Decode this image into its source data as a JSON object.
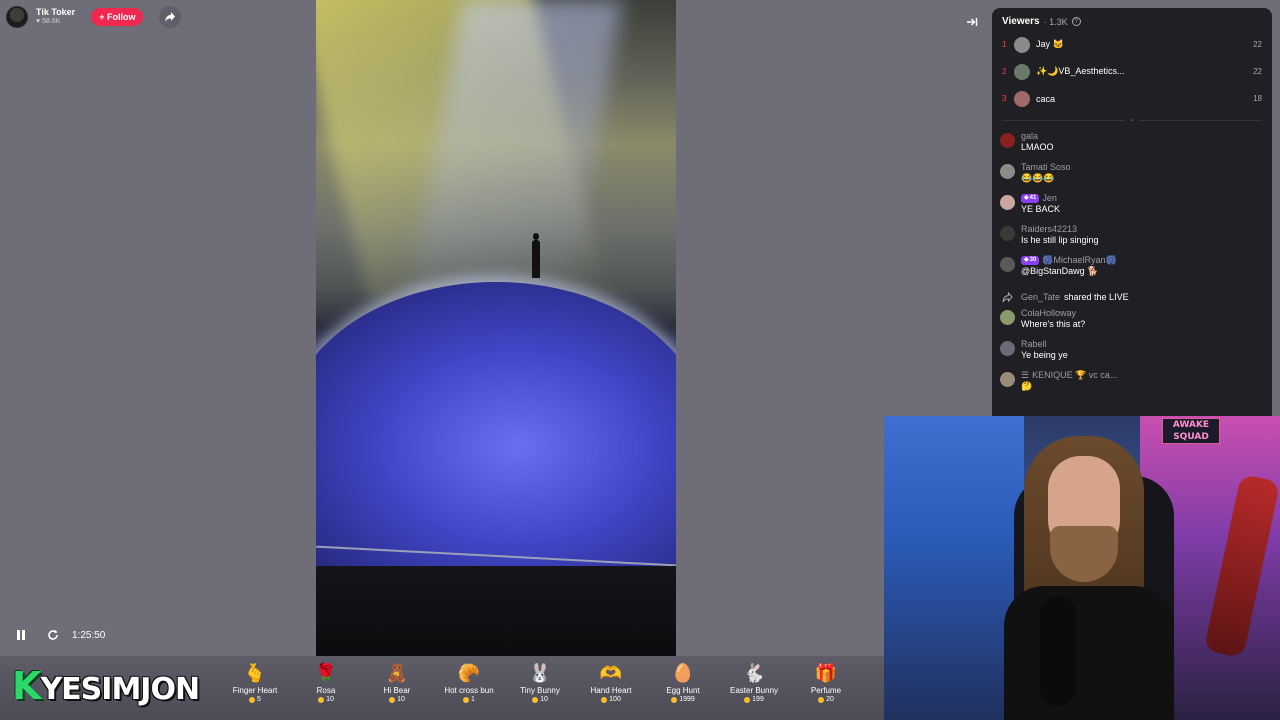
{
  "host": {
    "name": "Tik Toker",
    "likes": "58.6K",
    "follow_label": "+ Follow"
  },
  "player": {
    "timestamp": "1:25:50"
  },
  "brand": {
    "logo_k": "K",
    "logo_rest": "YESIMJON"
  },
  "gifts": [
    {
      "name": "Finger Heart",
      "price": "5",
      "icon": "🫰",
      "icon_name": "finger-heart-icon"
    },
    {
      "name": "Rosa",
      "price": "10",
      "icon": "🌹",
      "icon_name": "rose-icon"
    },
    {
      "name": "Hi Bear",
      "price": "10",
      "icon": "🧸",
      "icon_name": "bear-icon"
    },
    {
      "name": "Hot cross bun",
      "price": "1",
      "icon": "🥐",
      "icon_name": "bun-icon"
    },
    {
      "name": "Tiny Bunny",
      "price": "10",
      "icon": "🐰",
      "icon_name": "bunny-icon"
    },
    {
      "name": "Hand Heart",
      "price": "100",
      "icon": "🫶",
      "icon_name": "hand-heart-icon"
    },
    {
      "name": "Egg Hunt",
      "price": "1999",
      "icon": "🥚",
      "icon_name": "egg-icon"
    },
    {
      "name": "Easter Bunny",
      "price": "199",
      "icon": "🐇",
      "icon_name": "easter-bunny-icon"
    },
    {
      "name": "Perfume",
      "price": "20",
      "icon": "🎁",
      "icon_name": "perfume-icon"
    }
  ],
  "viewers": {
    "title": "Viewers",
    "count": "· 1.3K",
    "top": [
      {
        "rank": "1",
        "name": "Jay 🐱",
        "score": "22",
        "avatar_color": "#8a8a8a"
      },
      {
        "rank": "2",
        "name": "✨🌙VB_Aesthetics...",
        "score": "22",
        "avatar_color": "#6a7a6a"
      },
      {
        "rank": "3",
        "name": "caca",
        "score": "18",
        "avatar_color": "#a06a6a"
      }
    ]
  },
  "chat": [
    {
      "user": "gala",
      "msg": "LMAOO",
      "avatar_color": "#8a2020",
      "badge": ""
    },
    {
      "user": "Tamati Soso",
      "msg": "😂😂😂",
      "avatar_color": "#8b8b8b",
      "badge": ""
    },
    {
      "user": "Jen",
      "msg": "YE BACK",
      "avatar_color": "#c9a8a0",
      "badge": "41"
    },
    {
      "user": "Raiders42213",
      "msg": "Is he still lip singing",
      "avatar_color": "#3a3a3a",
      "badge": ""
    },
    {
      "user": "🎆MichaelRyan🎆",
      "msg": "@BigStanDawg 🐕",
      "avatar_color": "#5a5a5a",
      "badge": "30"
    },
    {
      "user": "ColaHolloway",
      "msg": "Where's this at?",
      "avatar_color": "#8a9a6a",
      "badge": ""
    },
    {
      "user": "Rabell",
      "msg": "Ye being ye",
      "avatar_color": "#6a6a7a",
      "badge": ""
    },
    {
      "user": "KENIQUE 🏆 vc ca...",
      "msg": "🤔",
      "avatar_color": "#9a8a7a",
      "badge": ""
    }
  ],
  "system_event": {
    "user": "Gen_Tate",
    "text": "shared the LIVE"
  },
  "webcam": {
    "sign_text": "AWAKE SQUAD"
  },
  "colors": {
    "accent": "#f0284f",
    "panel_bg": "#1f1f24",
    "page_bg": "#6e6d78",
    "rank": "#ff3b5c",
    "badge": "#8b3ff2",
    "coin": "#f4c12b"
  }
}
